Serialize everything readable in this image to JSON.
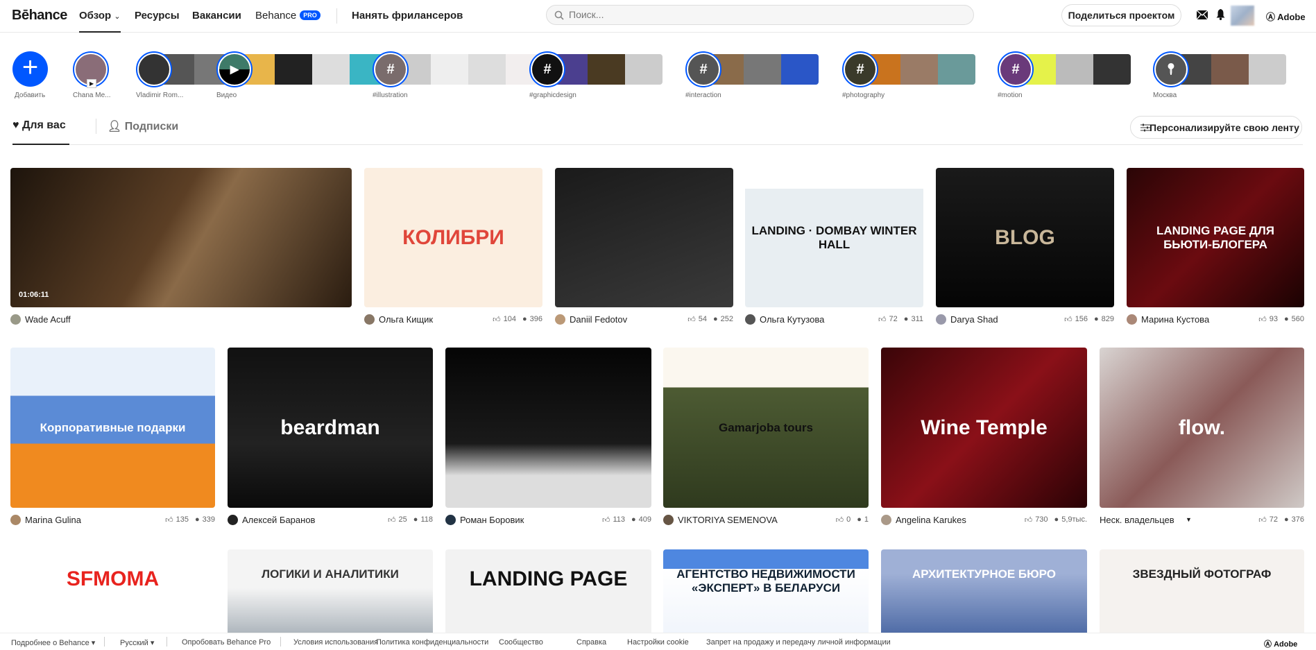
{
  "header": {
    "logo": "Bēhance",
    "nav": [
      "Обзор",
      "Ресурсы",
      "Вакансии",
      "Behance"
    ],
    "pro_badge": "PRO",
    "hire": "Нанять фрилансеров",
    "search_placeholder": "Поиск...",
    "share": "Поделиться проектом",
    "adobe": "Adobe"
  },
  "stories": {
    "add_label": "Добавить",
    "items": [
      {
        "label": "Chana Me...",
        "type": "user",
        "color": "#8a6d78",
        "strip": []
      },
      {
        "label": "Vladimir Rom...",
        "type": "user",
        "color": "#333",
        "strip": [
          "#555",
          "#777"
        ]
      },
      {
        "label": "Видео",
        "type": "video",
        "color": "#3e7a68",
        "strip": [
          "#e8b54a",
          "#222",
          "#ddd",
          "#3ab5c4"
        ]
      },
      {
        "label": "#illustration",
        "type": "tag",
        "color": "#7a6c6c",
        "strip": [
          "#ccc",
          "#eee",
          "#ddd",
          "#f2eeee"
        ]
      },
      {
        "label": "#graphicdesign",
        "type": "tag",
        "color": "#111",
        "strip": [
          "#4b3f8f",
          "#4a3a22",
          "#ccc"
        ]
      },
      {
        "label": "#interaction",
        "type": "tag",
        "color": "#555",
        "strip": [
          "#8a6b4a",
          "#777",
          "#2a56c7"
        ]
      },
      {
        "label": "#photography",
        "type": "tag",
        "color": "#3a3a2a",
        "strip": [
          "#c9731e",
          "#9a7b66",
          "#6a9a9a"
        ]
      },
      {
        "label": "#motion",
        "type": "tag",
        "color": "#6a3a7a",
        "strip": [
          "#e5f24a",
          "#bbb",
          "#333"
        ]
      },
      {
        "label": "Москва",
        "type": "place",
        "color": "#555",
        "strip": [
          "#444",
          "#7a5a4a",
          "#ccc"
        ]
      }
    ]
  },
  "tabs": {
    "for_you": "Для вас",
    "following": "Подписки",
    "personalize": "Персонализируйте свою ленту"
  },
  "rows": [
    [
      {
        "owner": "Wade Acuff",
        "duration": "01:06:11",
        "caption": "",
        "bg": "linear-gradient(120deg,#1d140c,#5c3f25 45%,#8a6a48 55%,#2a1c10)",
        "fg": "#fff",
        "av": "#998"
      },
      {
        "owner": "Ольга Кищик",
        "likes": "104",
        "views": "396",
        "caption": "КОЛИБРИ",
        "bg": "#fbeee0",
        "fg": "#e0463a",
        "av": "#876"
      },
      {
        "owner": "Daniil Fedotov",
        "likes": "54",
        "views": "252",
        "caption": "",
        "bg": "linear-gradient(160deg,#1a1a1a,#3a3a3a)",
        "fg": "#fff",
        "av": "#b97"
      },
      {
        "owner": "Ольга Кутузова",
        "likes": "72",
        "views": "311",
        "caption": "LANDING · DOMBAY WINTER HALL",
        "bg": "linear-gradient(#fff 15%,#e8eef2 15%)",
        "fg": "#111",
        "av": "#555"
      },
      {
        "owner": "Darya Shad",
        "likes": "156",
        "views": "829",
        "caption": "BLOG",
        "bg": "linear-gradient(#1a1a1a,#050505)",
        "fg": "#c9b79a",
        "av": "#99a"
      },
      {
        "owner": "Марина Кустова",
        "likes": "93",
        "views": "560",
        "caption": "LANDING PAGE ДЛЯ БЬЮТИ-БЛОГЕРА",
        "bg": "linear-gradient(135deg,#2a0506,#6b0b10,#1a0202)",
        "fg": "#fff",
        "av": "#a87"
      }
    ],
    [
      {
        "owner": "Marina Gulina",
        "likes": "135",
        "views": "339",
        "caption": "Корпоративные подарки",
        "bg": "linear-gradient(#e9f1fa 30%,#5b8bd6 30%,#5b8bd6 60%,#f08a1f 60%)",
        "fg": "#fff",
        "av": "#a86"
      },
      {
        "owner": "Алексей Баранов",
        "likes": "25",
        "views": "118",
        "caption": "beardman",
        "bg": "linear-gradient(#111,#222 60%,#0a0a0a)",
        "fg": "#fff",
        "av": "#222"
      },
      {
        "owner": "Роман Боровик",
        "likes": "113",
        "views": "409",
        "caption": "",
        "bg": "linear-gradient(#050505,#1a1a1a 60%,#ddd 80%)",
        "fg": "#fff",
        "av": "#234"
      },
      {
        "owner": "VIKTORIYA SEMENOVA",
        "likes": "0",
        "views": "1",
        "caption": "Gamarjoba tours",
        "bg": "linear-gradient(#fbf7ef 25%,#4d5b33 25%,#2f3a1e)",
        "fg": "#111",
        "av": "#654"
      },
      {
        "owner": "Angelina Karukes",
        "likes": "730",
        "views": "5,9тыс.",
        "caption": "Wine Temple",
        "bg": "linear-gradient(135deg,#3a0508,#8a1018,#2a0205)",
        "fg": "#fff",
        "av": "#a98"
      },
      {
        "owner": "Неск. владельцев",
        "likes": "72",
        "views": "376",
        "caption": "flow.",
        "bg": "linear-gradient(135deg,#d9d4d2,#8a5a58 50%,#cfc9c6)",
        "fg": "#fff",
        "av": "",
        "multi": true
      }
    ],
    [
      {
        "caption": "SFMOMA",
        "bg": "#fff",
        "fg": "#e8231e"
      },
      {
        "caption": "ЛОГИКИ И АНАЛИТИКИ",
        "bg": "linear-gradient(#f4f4f4 40%,#9aa4ad)",
        "fg": "#333"
      },
      {
        "caption": "LANDING PAGE",
        "bg": "#f2f2f2",
        "fg": "#111"
      },
      {
        "caption": "АГЕНТСТВО НЕДВИЖИМОСТИ «ЭКСПЕРТ» В БЕЛАРУСИ",
        "bg": "linear-gradient(#4e87e0 20%,#fff 20%,#eef3fb)",
        "fg": "#123"
      },
      {
        "caption": "АРХИТЕКТУРНОЕ БЮРО",
        "bg": "linear-gradient(#9fb0d6 25%,#3e5d9c)",
        "fg": "#fff"
      },
      {
        "caption": "ЗВЕЗДНЫЙ ФОТОГРАФ",
        "bg": "#f5f2ef",
        "fg": "#222"
      }
    ]
  ],
  "footer": {
    "items": [
      "Подробнее о Behance ▾",
      "Русский ▾",
      "Опробовать Behance Pro",
      "Условия использования",
      "Политика конфиденциальности",
      "Сообщество",
      "Справка",
      "Настройки cookie",
      "Запрет на продажу и передачу личной информации"
    ],
    "adobe": "Adobe"
  },
  "colors": {
    "accent": "#0057ff"
  }
}
